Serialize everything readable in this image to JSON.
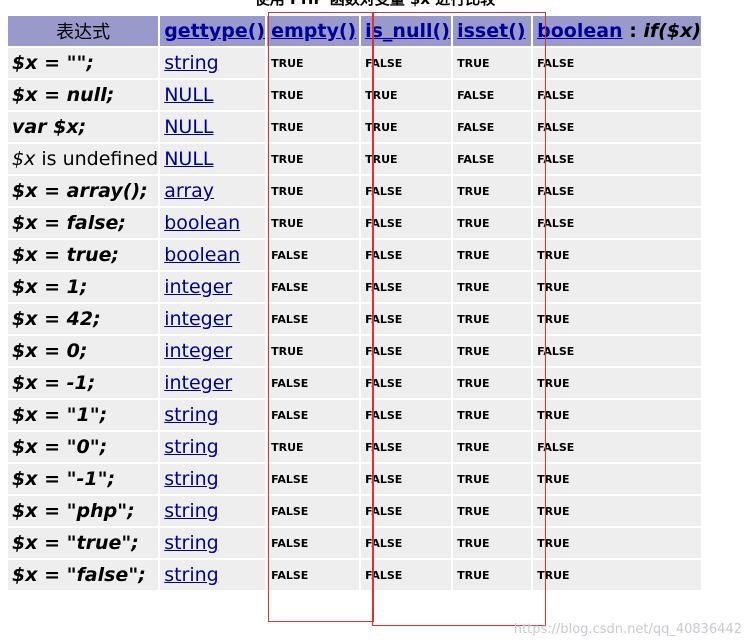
{
  "caption": "使用 PHP 函数对变量 $x 进行比较",
  "headers": {
    "expression": "表达式",
    "gettype": "gettype()",
    "empty": "empty()",
    "is_null": "is_null()",
    "isset": "isset()",
    "boolean": "boolean",
    "boolean_colon": " : ",
    "boolean_if": "if($x)"
  },
  "rows": [
    {
      "expr": "$x = \"\";",
      "type": "string",
      "empty": "TRUE",
      "is_null": "FALSE",
      "isset": "TRUE",
      "boolean": "FALSE"
    },
    {
      "expr": "$x = null;",
      "type": "NULL",
      "empty": "TRUE",
      "is_null": "TRUE",
      "isset": "FALSE",
      "boolean": "FALSE"
    },
    {
      "expr": "var $x;",
      "type": "NULL",
      "empty": "TRUE",
      "is_null": "TRUE",
      "isset": "FALSE",
      "boolean": "FALSE"
    },
    {
      "expr_var": "$x",
      "expr_rest": " is undefined",
      "type": "NULL",
      "empty": "TRUE",
      "is_null": "TRUE",
      "isset": "FALSE",
      "boolean": "FALSE"
    },
    {
      "expr": "$x = array();",
      "type": "array",
      "empty": "TRUE",
      "is_null": "FALSE",
      "isset": "TRUE",
      "boolean": "FALSE"
    },
    {
      "expr": "$x = false;",
      "type": "boolean",
      "empty": "TRUE",
      "is_null": "FALSE",
      "isset": "TRUE",
      "boolean": "FALSE"
    },
    {
      "expr": "$x = true;",
      "type": "boolean",
      "empty": "FALSE",
      "is_null": "FALSE",
      "isset": "TRUE",
      "boolean": "TRUE"
    },
    {
      "expr": "$x = 1;",
      "type": "integer",
      "empty": "FALSE",
      "is_null": "FALSE",
      "isset": "TRUE",
      "boolean": "TRUE"
    },
    {
      "expr": "$x = 42;",
      "type": "integer",
      "empty": "FALSE",
      "is_null": "FALSE",
      "isset": "TRUE",
      "boolean": "TRUE"
    },
    {
      "expr": "$x = 0;",
      "type": "integer",
      "empty": "TRUE",
      "is_null": "FALSE",
      "isset": "TRUE",
      "boolean": "FALSE"
    },
    {
      "expr": "$x = -1;",
      "type": "integer",
      "empty": "FALSE",
      "is_null": "FALSE",
      "isset": "TRUE",
      "boolean": "TRUE"
    },
    {
      "expr": "$x = \"1\";",
      "type": "string",
      "empty": "FALSE",
      "is_null": "FALSE",
      "isset": "TRUE",
      "boolean": "TRUE"
    },
    {
      "expr": "$x = \"0\";",
      "type": "string",
      "empty": "TRUE",
      "is_null": "FALSE",
      "isset": "TRUE",
      "boolean": "FALSE"
    },
    {
      "expr": "$x = \"-1\";",
      "type": "string",
      "empty": "FALSE",
      "is_null": "FALSE",
      "isset": "TRUE",
      "boolean": "TRUE"
    },
    {
      "expr": "$x = \"php\";",
      "type": "string",
      "empty": "FALSE",
      "is_null": "FALSE",
      "isset": "TRUE",
      "boolean": "TRUE"
    },
    {
      "expr": "$x = \"true\";",
      "type": "string",
      "empty": "FALSE",
      "is_null": "FALSE",
      "isset": "TRUE",
      "boolean": "TRUE"
    },
    {
      "expr": "$x = \"false\";",
      "type": "string",
      "empty": "FALSE",
      "is_null": "FALSE",
      "isset": "TRUE",
      "boolean": "TRUE"
    }
  ],
  "watermark": "https://blog.csdn.net/qq_40836442",
  "colors": {
    "header_bg": "#9999cc",
    "row_bg": "#eeeeee",
    "link": "#000099",
    "highlight_box": "#e03030"
  }
}
